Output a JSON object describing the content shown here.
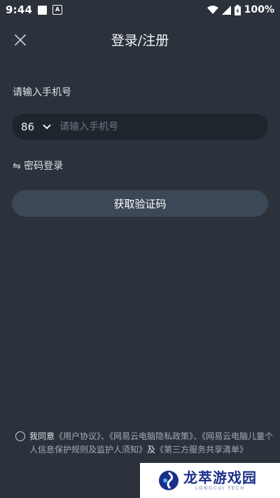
{
  "status_bar": {
    "time": "9:44",
    "battery": "100%",
    "icons": [
      "notification-square-icon",
      "a-badge-icon",
      "wifi-icon",
      "signal-icon",
      "battery-charging-icon"
    ]
  },
  "header": {
    "title": "登录/注册",
    "close_icon": "close-icon"
  },
  "form": {
    "phone_label": "请输入手机号",
    "country_code": "86",
    "phone_placeholder": "请输入手机号",
    "phone_value": "",
    "switch_label": "⇋ 密码登录",
    "submit_label": "获取验证码"
  },
  "agreement": {
    "checked": false,
    "prefix": "我同意",
    "user_agreement": "《用户协议》",
    "sep1": "、",
    "privacy_policy": "《网易云电脑隐私政策》",
    "sep2": "、",
    "child_policy": "《网易云电脑儿童个人信息保护规则及监护人须知》",
    "and": "及",
    "third_party": "《第三方服务共享清单》"
  },
  "watermark": {
    "name": "龙萃游戏园",
    "sub": "LONGCUI TECH"
  },
  "colors": {
    "background": "#2b323c",
    "input_bg": "#1f252d",
    "button_bg": "#3c4856",
    "text": "#e8ecf0",
    "muted": "#a3abb4"
  }
}
